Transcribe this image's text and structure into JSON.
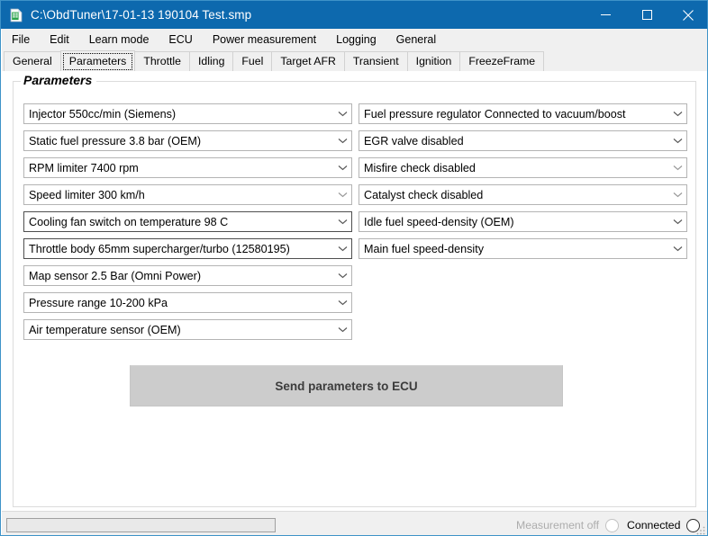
{
  "window": {
    "title": "C:\\ObdTuner\\17-01-13 190104 Test.smp",
    "icon": "document-spreadsheet-icon",
    "titlebar_color": "#0d69ae",
    "controls": {
      "minimize": "minimize-icon",
      "maximize": "maximize-icon",
      "close": "close-icon"
    }
  },
  "menubar": {
    "items": [
      {
        "label": "File"
      },
      {
        "label": "Edit"
      },
      {
        "label": "Learn mode"
      },
      {
        "label": "ECU"
      },
      {
        "label": "Power measurement"
      },
      {
        "label": "Logging"
      },
      {
        "label": "General"
      }
    ]
  },
  "tabs": {
    "selected": "Parameters",
    "items": [
      {
        "label": "General"
      },
      {
        "label": "Parameters"
      },
      {
        "label": "Throttle"
      },
      {
        "label": "Idling"
      },
      {
        "label": "Fuel"
      },
      {
        "label": "Target AFR"
      },
      {
        "label": "Transient"
      },
      {
        "label": "Ignition"
      },
      {
        "label": "FreezeFrame"
      }
    ]
  },
  "panel": {
    "title": "Parameters",
    "left_column": [
      {
        "value": "Injector 550cc/min (Siemens)"
      },
      {
        "value": "Static fuel pressure 3.8 bar (OEM)"
      },
      {
        "value": "RPM limiter 7400 rpm"
      },
      {
        "value": "Speed limiter 300 km/h"
      },
      {
        "value": "Cooling fan switch on temperature 98 C"
      },
      {
        "value": "Throttle body 65mm supercharger/turbo (12580195)"
      },
      {
        "value": "Map sensor 2.5 Bar (Omni Power)"
      },
      {
        "value": "Pressure range  10-200 kPa"
      },
      {
        "value": "Air temperature sensor (OEM)"
      }
    ],
    "right_column": [
      {
        "value": "Fuel pressure regulator Connected to vacuum/boost"
      },
      {
        "value": "EGR valve disabled"
      },
      {
        "value": "Misfire check disabled"
      },
      {
        "value": "Catalyst check disabled"
      },
      {
        "value": "Idle fuel speed-density (OEM)"
      },
      {
        "value": "Main fuel speed-density"
      }
    ],
    "send_button": "Send parameters to ECU"
  },
  "statusbar": {
    "progress_percent": 0,
    "measurement": {
      "label": "Measurement off",
      "state": "off"
    },
    "connection": {
      "label": "Connected",
      "state": "on"
    }
  }
}
